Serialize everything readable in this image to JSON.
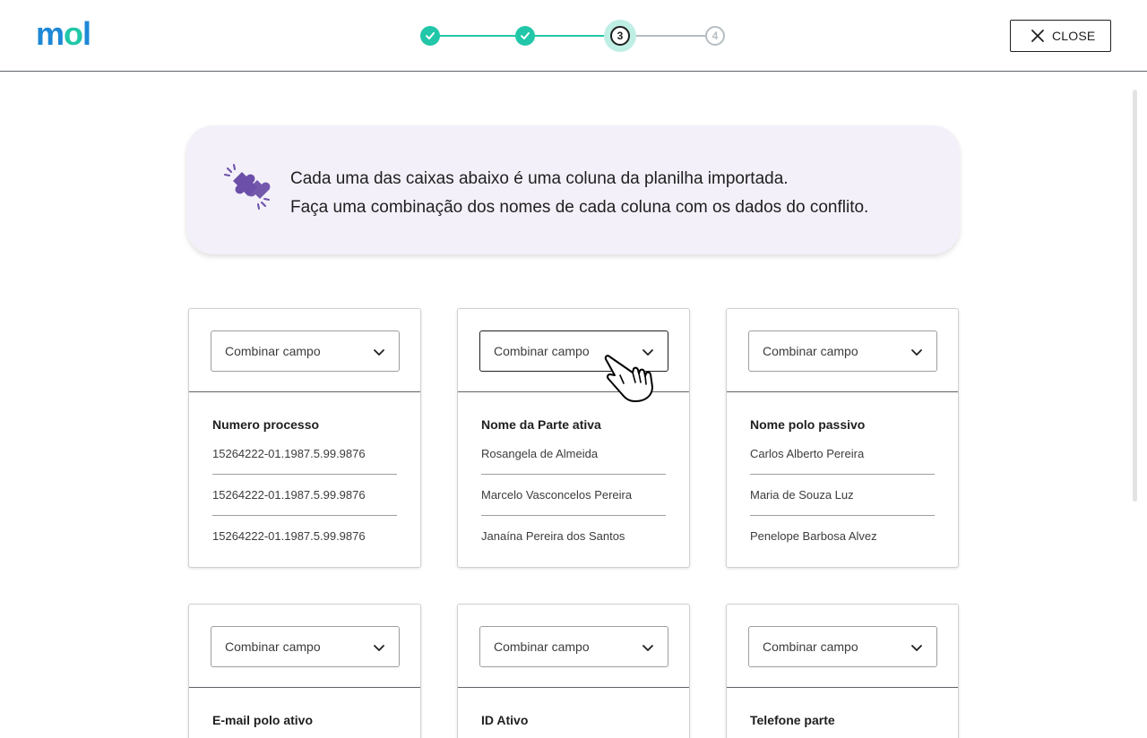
{
  "logo": {
    "m": "m",
    "o": "o",
    "l": "l"
  },
  "stepper": {
    "steps": [
      {
        "status": "done",
        "label": ""
      },
      {
        "status": "done",
        "label": ""
      },
      {
        "status": "current",
        "label": "3"
      },
      {
        "status": "todo",
        "label": "4"
      }
    ]
  },
  "close_button": {
    "label": "CLOSE"
  },
  "banner": {
    "line1": "Cada uma das caixas abaixo é uma coluna da planilha importada.",
    "line2": "Faça uma combinação dos nomes de cada coluna com os dados do conflito.",
    "icon": "puzzle-icon"
  },
  "cards": [
    {
      "select_label": "Combinar campo",
      "title": "Numero processo",
      "rows": [
        "15264222-01.1987.5.99.9876",
        "15264222-01.1987.5.99.9876",
        "15264222-01.1987.5.99.9876"
      ]
    },
    {
      "select_label": "Combinar campo",
      "title": "Nome da Parte ativa",
      "rows": [
        "Rosangela de Almeida",
        "Marcelo Vasconcelos Pereira",
        "Janaína Pereira dos Santos"
      ]
    },
    {
      "select_label": "Combinar campo",
      "title": "Nome polo passivo",
      "rows": [
        "Carlos Alberto Pereira",
        "Maria de Souza Luz",
        "Penelope Barbosa Alvez"
      ]
    },
    {
      "select_label": "Combinar campo",
      "title": "E-mail polo ativo",
      "rows": []
    },
    {
      "select_label": "Combinar campo",
      "title": "ID Ativo",
      "rows": []
    },
    {
      "select_label": "Combinar campo",
      "title": "Telefone parte",
      "rows": []
    }
  ],
  "colors": {
    "accent_teal": "#21c7a8",
    "logo_blue": "#1e88d6",
    "banner_bg": "#f3f0f9",
    "puzzle_purple": "#6b4fa8"
  }
}
